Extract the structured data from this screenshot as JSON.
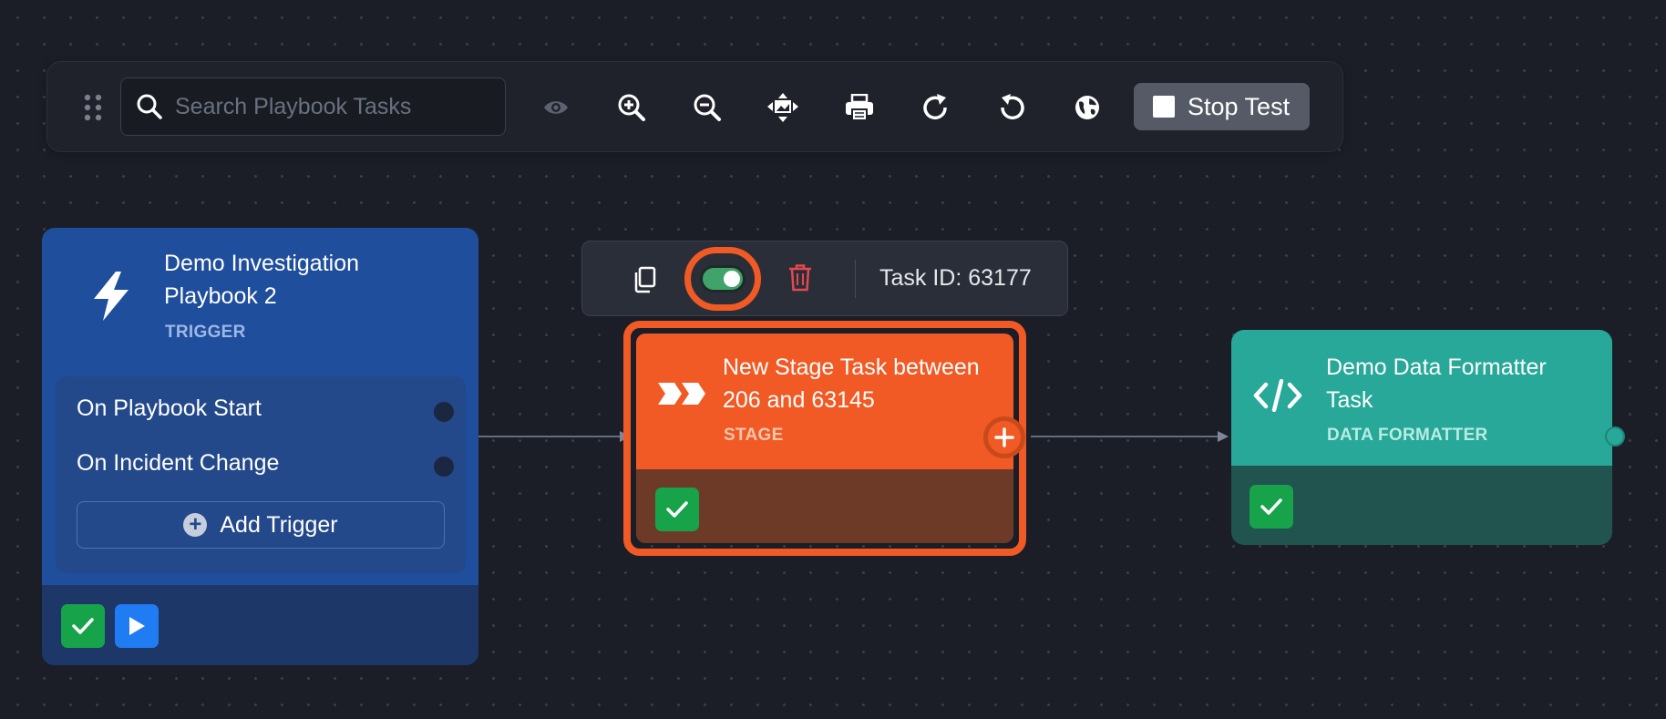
{
  "toolbar": {
    "search_placeholder": "Search Playbook Tasks",
    "icons": [
      "drag-handle-icon",
      "search-icon",
      "eye-icon",
      "zoom-in-icon",
      "zoom-out-icon",
      "fit-view-icon",
      "print-icon",
      "redo-icon",
      "undo-icon",
      "globe-icon",
      "stop-icon"
    ],
    "stop_label": "Stop Test"
  },
  "trigger_card": {
    "title": "Demo Investigation Playbook 2",
    "title_line1": "Demo Investigation",
    "title_line2": "Playbook 2",
    "type": "TRIGGER",
    "triggers": [
      "On Playbook Start",
      "On Incident Change"
    ],
    "add_label": "Add Trigger",
    "color": "#1f4e9c"
  },
  "task_toolbar": {
    "task_id_label": "Task ID: 63177",
    "toggle_on": true
  },
  "stage_card": {
    "title_line1": "New Stage Task between",
    "title_line2": "206 and 63145",
    "type": "STAGE",
    "color": "#f15a24"
  },
  "formatter_card": {
    "title_line1": "Demo Data Formatter",
    "title_line2": "Task",
    "type": "DATA FORMATTER",
    "color": "#27a898"
  }
}
